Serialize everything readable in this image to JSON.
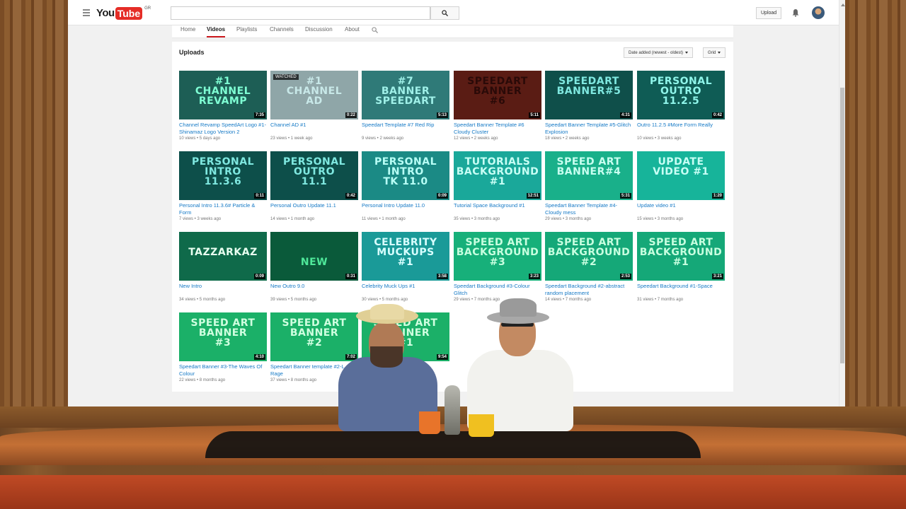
{
  "masthead": {
    "logo_you": "You",
    "logo_tube": "Tube",
    "region": "GR",
    "search_placeholder": "",
    "upload_label": "Upload"
  },
  "channel_nav": {
    "tabs": [
      {
        "label": "Home",
        "active": false
      },
      {
        "label": "Videos",
        "active": true
      },
      {
        "label": "Playlists",
        "active": false
      },
      {
        "label": "Channels",
        "active": false
      },
      {
        "label": "Discussion",
        "active": false
      },
      {
        "label": "About",
        "active": false
      }
    ]
  },
  "uploads": {
    "title": "Uploads",
    "sort_label": "Date added (newest - oldest)",
    "view_label": "Grid",
    "videos": [
      {
        "thumb_text": "#1\nCHANNEL\nREVAMP",
        "thumb_bg": "#1d5e55",
        "thumb_color": "#7fffd4",
        "duration": "7:35",
        "title": "Channel Revamp SpeedArt Logo #1-Shinamaz Logo Version 2",
        "views": "10 views",
        "age": "5 days ago",
        "watched": ""
      },
      {
        "thumb_text": "#1\nCHANNEL\nAD",
        "thumb_bg": "#8fa6a8",
        "thumb_color": "#c8e8e8",
        "duration": "0:22",
        "title": "Channel AD #1",
        "views": "23 views",
        "age": "1 week ago",
        "watched": "WATCHED"
      },
      {
        "thumb_text": "#7\nBANNER\nSPEEDART",
        "thumb_bg": "#2f7a78",
        "thumb_color": "#9ff0e8",
        "duration": "5:13",
        "title": "Speedart Template #7 Red Rip",
        "views": "9 views",
        "age": "2 weeks ago",
        "watched": ""
      },
      {
        "thumb_text": "SPEEDART\nBANNER\n#6",
        "thumb_bg": "#5a1c14",
        "thumb_color": "#2a0a08",
        "duration": "5:11",
        "title": "Speedart Banner Template #6 Cloudy Cluster",
        "views": "12 views",
        "age": "2 weeks ago",
        "watched": ""
      },
      {
        "thumb_text": "SPEEDART\nBANNER#5",
        "thumb_bg": "#0f4f4a",
        "thumb_color": "#7fe8e0",
        "duration": "4:31",
        "title": "Speedart Banner Template #5-Glitch Explosion",
        "views": "18 views",
        "age": "2 weeks ago",
        "watched": ""
      },
      {
        "thumb_text": "PERSONAL\nOUTRO\n11.2.5",
        "thumb_bg": "#0f5c55",
        "thumb_color": "#8ff5ea",
        "duration": "0:42",
        "title": "Outro 11.2.5 #More Form Really",
        "views": "10 views",
        "age": "3 weeks ago",
        "watched": ""
      },
      {
        "thumb_text": "PERSONAL\nINTRO\n11.3.6",
        "thumb_bg": "#0d4f4a",
        "thumb_color": "#7fe8e0",
        "duration": "0:11",
        "title": "Personal Intro 11.3.6# Particle & Form",
        "views": "7 views",
        "age": "3 weeks ago",
        "watched": ""
      },
      {
        "thumb_text": "PERSONAL\nOUTRO\n11.1",
        "thumb_bg": "#0d4f4a",
        "thumb_color": "#7fe8e0",
        "duration": "0:42",
        "title": "Personal Outro Update 11.1",
        "views": "14 views",
        "age": "1 month ago",
        "watched": ""
      },
      {
        "thumb_text": "PERSONAL\nINTRO\nTK 11.0",
        "thumb_bg": "#1b8a85",
        "thumb_color": "#b8fff6",
        "duration": "0:09",
        "title": "Personal Intro Update 11.0",
        "views": "11 views",
        "age": "1 month ago",
        "watched": ""
      },
      {
        "thumb_text": "TUTORIALS\nBACKGROUND\n#1",
        "thumb_bg": "#1aa89a",
        "thumb_color": "#c8fff5",
        "duration": "12:51",
        "title": "Tutorial Space Background #1",
        "views": "35 views",
        "age": "3 months ago",
        "watched": ""
      },
      {
        "thumb_text": "SPEED ART\nBANNER#4",
        "thumb_bg": "#19b08a",
        "thumb_color": "#c8fff0",
        "duration": "5:31",
        "title": "Speedart Banner Template #4-Cloudy mess",
        "views": "29 views",
        "age": "3 months ago",
        "watched": ""
      },
      {
        "thumb_text": "UPDATE\nVIDEO #1",
        "thumb_bg": "#17b49a",
        "thumb_color": "#c8fff5",
        "duration": "1:20",
        "title": "Update video #1",
        "views": "15 views",
        "age": "3 months ago",
        "watched": ""
      },
      {
        "thumb_text": "\nTAZZARKAZ",
        "thumb_bg": "#0f6a4a",
        "thumb_color": "#e8fff0",
        "duration": "0:09",
        "title": "New Intro",
        "views": "34 views",
        "age": "5 months ago",
        "watched": ""
      },
      {
        "thumb_text": "\n\nNEW",
        "thumb_bg": "#0a5a3a",
        "thumb_color": "#4fe89a",
        "duration": "0:31",
        "title": "New Outro 9.0",
        "views": "39 views",
        "age": "5 months ago",
        "watched": ""
      },
      {
        "thumb_text": "CELEBRITY\nMUCKUPS\n#1",
        "thumb_bg": "#1a9a98",
        "thumb_color": "#d8ffff",
        "duration": "3:58",
        "title": "Celebrity Muck Ups #1",
        "views": "30 views",
        "age": "5 months ago",
        "watched": ""
      },
      {
        "thumb_text": "SPEED ART\nBACKGROUND\n#3",
        "thumb_bg": "#17b07a",
        "thumb_color": "#c8ffe0",
        "duration": "3:23",
        "title": "Speedart Background #3-Colour Glitch",
        "views": "29 views",
        "age": "7 months ago",
        "watched": ""
      },
      {
        "thumb_text": "SPEED ART\nBACKGROUND\n#2",
        "thumb_bg": "#15a878",
        "thumb_color": "#c8ffe0",
        "duration": "2:53",
        "title": "Speedart Background #2-abstract random placement",
        "views": "14 views",
        "age": "7 months ago",
        "watched": ""
      },
      {
        "thumb_text": "SPEED ART\nBACKGROUND\n#1",
        "thumb_bg": "#15a878",
        "thumb_color": "#c8ffe0",
        "duration": "3:21",
        "title": "Speedart Background #1-Space",
        "views": "31 views",
        "age": "7 months ago",
        "watched": ""
      },
      {
        "thumb_text": "SPEED ART\nBANNER\n#3",
        "thumb_bg": "#1bb068",
        "thumb_color": "#d0ffe0",
        "duration": "4:10",
        "title": "Speedart Banner #3-The Waves Of Colour",
        "views": "22 views",
        "age": "8 months ago",
        "watched": ""
      },
      {
        "thumb_text": "SPEED ART\nBANNER\n#2",
        "thumb_bg": "#1bb068",
        "thumb_color": "#d0ffe0",
        "duration": "7:02",
        "title": "Speedart Banner template #2-L Rage",
        "views": "37 views",
        "age": "8 months ago",
        "watched": ""
      },
      {
        "thumb_text": "SPEED ART\nBANNER\n#1",
        "thumb_bg": "#1bb068",
        "thumb_color": "#d0ffe0",
        "duration": "9:54",
        "title": "",
        "views": "",
        "age": "",
        "watched": ""
      }
    ]
  },
  "colors": {
    "link": "#167ac6",
    "accent_red": "#cc181e",
    "wood": "#8a5a2e"
  }
}
